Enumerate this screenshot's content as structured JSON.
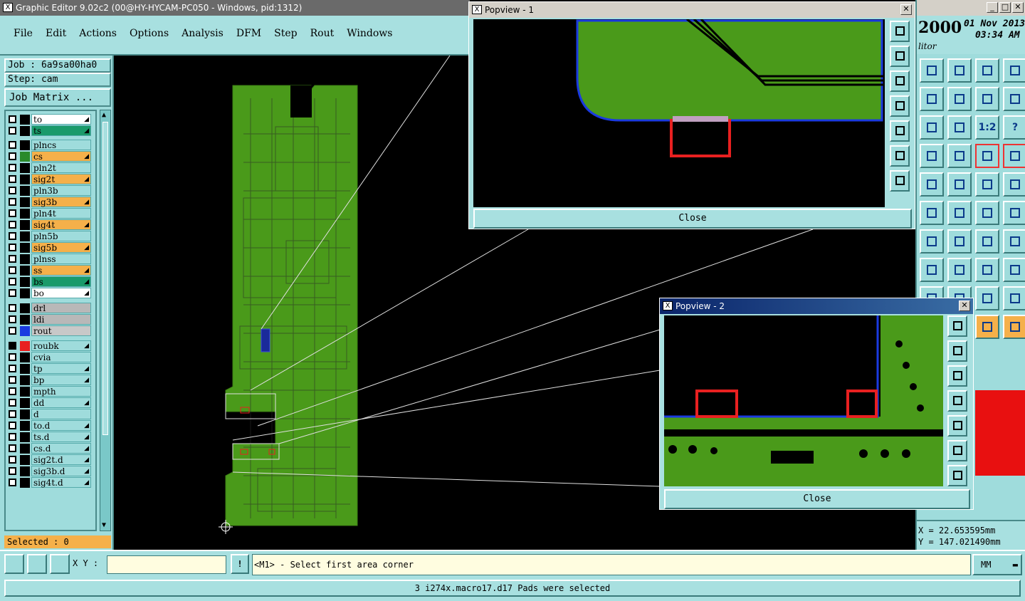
{
  "main_window": {
    "title": "Graphic Editor 9.02c2 (00@HY-HYCAM-PC050 - Windows, pid:1312)"
  },
  "menu": [
    "File",
    "Edit",
    "Actions",
    "Options",
    "Analysis",
    "DFM",
    "Step",
    "Rout",
    "Windows"
  ],
  "job": {
    "job_label": "Job : 6a9sa00ha0",
    "step_label": "Step: cam",
    "matrix_button": "Job Matrix ..."
  },
  "layers": [
    {
      "name": "to",
      "color": "#ffffff",
      "swatch": "#000000",
      "checked": false,
      "arrow": true
    },
    {
      "name": "ts",
      "color": "#1a9a6a",
      "swatch": "#000000",
      "checked": false,
      "arrow": true
    },
    {
      "name": "plncs",
      "color": "#9fdcdc",
      "swatch": "#000000",
      "checked": false,
      "arrow": false
    },
    {
      "name": "cs",
      "color": "#f5b04a",
      "swatch": "#2a8a2a",
      "checked": false,
      "arrow": true
    },
    {
      "name": "pln2t",
      "color": "#9fdcdc",
      "swatch": "#000000",
      "checked": false,
      "arrow": false
    },
    {
      "name": "sig2t",
      "color": "#f5b04a",
      "swatch": "#000000",
      "checked": false,
      "arrow": true
    },
    {
      "name": "pln3b",
      "color": "#9fdcdc",
      "swatch": "#000000",
      "checked": false,
      "arrow": false
    },
    {
      "name": "sig3b",
      "color": "#f5b04a",
      "swatch": "#000000",
      "checked": false,
      "arrow": true
    },
    {
      "name": "pln4t",
      "color": "#9fdcdc",
      "swatch": "#000000",
      "checked": false,
      "arrow": false
    },
    {
      "name": "sig4t",
      "color": "#f5b04a",
      "swatch": "#000000",
      "checked": false,
      "arrow": true
    },
    {
      "name": "pln5b",
      "color": "#9fdcdc",
      "swatch": "#000000",
      "checked": false,
      "arrow": false
    },
    {
      "name": "sig5b",
      "color": "#f5b04a",
      "swatch": "#000000",
      "checked": false,
      "arrow": true
    },
    {
      "name": "plnss",
      "color": "#9fdcdc",
      "swatch": "#000000",
      "checked": false,
      "arrow": false
    },
    {
      "name": "ss",
      "color": "#f5b04a",
      "swatch": "#000000",
      "checked": false,
      "arrow": true
    },
    {
      "name": "bs",
      "color": "#1a9a6a",
      "swatch": "#000000",
      "checked": false,
      "arrow": true
    },
    {
      "name": "bo",
      "color": "#ffffff",
      "swatch": "#000000",
      "checked": false,
      "arrow": true
    },
    {
      "name": "drl",
      "color": "#b8b8b8",
      "swatch": "#000000",
      "checked": false,
      "arrow": false
    },
    {
      "name": "ldi",
      "color": "#b8b8b8",
      "swatch": "#000000",
      "checked": false,
      "arrow": false
    },
    {
      "name": "rout",
      "color": "#c8c8c8",
      "swatch": "#1a3ae0",
      "checked": false,
      "arrow": false
    },
    {
      "name": "roubk",
      "color": "#9fdcdc",
      "swatch": "#e82020",
      "checked": true,
      "arrow": true
    },
    {
      "name": "cvia",
      "color": "#9fdcdc",
      "swatch": "#000000",
      "checked": false,
      "arrow": false
    },
    {
      "name": "tp",
      "color": "#9fdcdc",
      "swatch": "#000000",
      "checked": false,
      "arrow": true
    },
    {
      "name": "bp",
      "color": "#9fdcdc",
      "swatch": "#000000",
      "checked": false,
      "arrow": true
    },
    {
      "name": "mpth",
      "color": "#9fdcdc",
      "swatch": "#000000",
      "checked": false,
      "arrow": false
    },
    {
      "name": "dd",
      "color": "#9fdcdc",
      "swatch": "#000000",
      "checked": false,
      "arrow": true
    },
    {
      "name": "d",
      "color": "#9fdcdc",
      "swatch": "#000000",
      "checked": false,
      "arrow": false
    },
    {
      "name": "to.d",
      "color": "#9fdcdc",
      "swatch": "#000000",
      "checked": false,
      "arrow": true
    },
    {
      "name": "ts.d",
      "color": "#9fdcdc",
      "swatch": "#000000",
      "checked": false,
      "arrow": true
    },
    {
      "name": "cs.d",
      "color": "#9fdcdc",
      "swatch": "#000000",
      "checked": false,
      "arrow": true
    },
    {
      "name": "sig2t.d",
      "color": "#9fdcdc",
      "swatch": "#000000",
      "checked": false,
      "arrow": true
    },
    {
      "name": "sig3b.d",
      "color": "#9fdcdc",
      "swatch": "#000000",
      "checked": false,
      "arrow": true
    },
    {
      "name": "sig4t.d",
      "color": "#9fdcdc",
      "swatch": "#000000",
      "checked": false,
      "arrow": true
    }
  ],
  "selected_label": "Selected : 0",
  "popview1": {
    "title": "Popview - 1",
    "close": "Close"
  },
  "popview2": {
    "title": "Popview - 2",
    "close": "Close"
  },
  "top_right": {
    "year": "2000",
    "date": "01 Nov 2013",
    "time": "03:34 AM",
    "editor": "litor"
  },
  "coords": {
    "x": "X = 22.653595mm",
    "y": "Y = 147.021490mm"
  },
  "bottom": {
    "xy_label": "X Y :",
    "xy_value": "",
    "exclaim": "!",
    "prompt": "<M1> - Select first area corner",
    "units": "MM",
    "status": "3 i274x.macro17.d17 Pads were selected"
  },
  "toolbox_icons": [
    "up-layer-icon",
    "down-layer-icon",
    "home-icon",
    "split-view-icon",
    "pan-right-icon",
    "pan-left-icon",
    "undo-icon",
    "redo-icon",
    "zoom-fit-icon",
    "zoom-center-icon",
    "zoom-ratio-icon",
    "help-icon",
    "measure-icon",
    "probe-icon",
    "snap-left-icon",
    "snap-right-icon",
    "pad-icon",
    "color-icon",
    "ruler-icon",
    "circle-icon",
    "net-icon",
    "cross-icon",
    "connect-icon",
    "connect-alt-icon",
    "line-icon",
    "line-diag-icon",
    "arc-icon",
    "text-icon",
    "select-pad-icon",
    "dash-icon",
    "mirror-icon",
    "group-icon",
    "blank-icon",
    "blank-icon",
    "arc-red-icon",
    "arc-blue-icon",
    "blank-icon",
    "blank-icon",
    "cursor-icon",
    "cursor-alt-icon"
  ],
  "toolbox_labels": {
    "zoom-ratio-icon": "1:2",
    "help-icon": "?"
  }
}
